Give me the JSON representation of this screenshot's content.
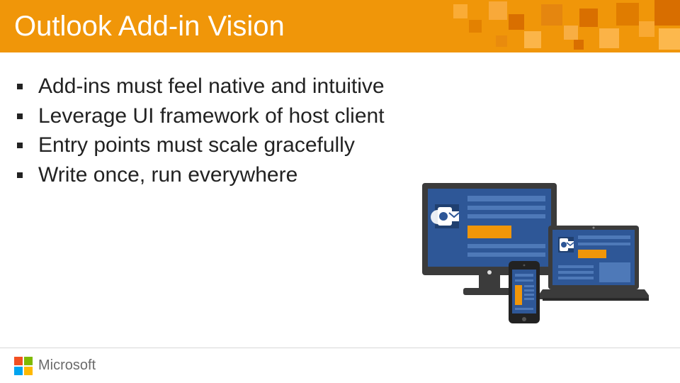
{
  "header": {
    "title": "Outlook Add-in Vision"
  },
  "bullets": [
    "Add-ins must feel native and intuitive",
    "Leverage UI framework of host client",
    "Entry points must scale gracefully",
    "Write once, run everywhere"
  ],
  "footer": {
    "company": "Microsoft"
  }
}
